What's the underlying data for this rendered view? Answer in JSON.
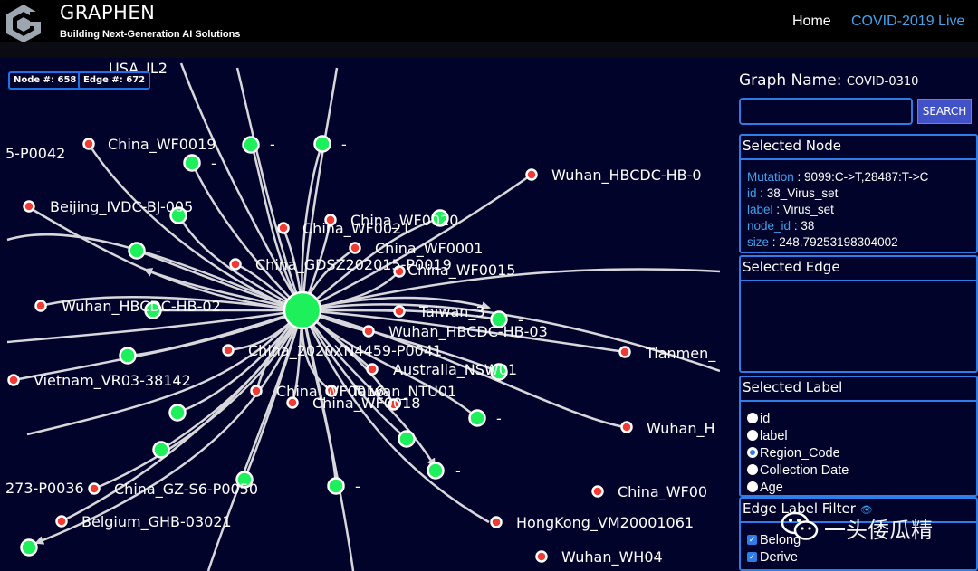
{
  "header": {
    "title": "GRAPHEN",
    "subtitle": "Building Next-Generation AI Solutions",
    "nav": {
      "home": "Home",
      "live": "COVID-2019 Live"
    }
  },
  "graph": {
    "node_count_label": "Node #: 658",
    "edge_count_label": "Edge #: 672",
    "labels": {
      "usa_il2": "USA_IL2",
      "p0042": "5-P0042",
      "china_wf0019": "China_WF0019",
      "dash1": "-",
      "dash2": "-",
      "dash3": "-",
      "dash4": "-",
      "dash5": "-",
      "dash6": "-",
      "dash7": "-",
      "dash8": "-",
      "dash9": "-",
      "wuhan_hbcdc_hb_0": "Wuhan_HBCDC-HB-0",
      "beijing": "Beijing_IVDC-BJ-005",
      "china_wf0021": "China_WF0021",
      "china_wf0020": "China_WF0020",
      "china_wf0001": "China_WF0001",
      "china_gdsz": "China_GDSZ202015-P0019",
      "china_wf0015": "China_WF0015",
      "wuhan_hb02": "Wuhan_HBCDC-HB-02",
      "taiwan3": "Taiwan_3",
      "wuhan_hb03": "Wuhan_HBCDC-HB-03",
      "china_2020xn": "China_2020XN4459-P0041",
      "tianmen": "Tianmen_",
      "vietnam": "Vietnam_VR03-38142",
      "australia": "Australia_NSW01",
      "china_wf0016": "China_WF0016",
      "taiwan_ntu": "Taiwan_NTU01",
      "china_wf0018": "China_WF0018",
      "wuhan_h": "Wuhan_H",
      "p0036": "273-P0036",
      "china_gz": "China_GZ-S6-P0050",
      "china_wf00": "China_WF00",
      "belgium": "Belgium_GHB-03021",
      "hongkong": "HongKong_VM20001061",
      "wuhan_wh04": "Wuhan_WH04"
    },
    "colors": {
      "hub": "#1df05a",
      "virus_set": "#1df05a",
      "sample": "#f03a32",
      "edge": "#d8d8dc"
    }
  },
  "panel": {
    "graph_name_label": "Graph Name:",
    "graph_name_value": "COVID-0310",
    "search_value": "",
    "search_button": "SEARCH",
    "selected_node": {
      "title": "Selected Node",
      "props": [
        {
          "key": "Mutation",
          "value": "9099:C->T,28487:T->C"
        },
        {
          "key": "id",
          "value": "38_Virus_set"
        },
        {
          "key": "label",
          "value": "Virus_set"
        },
        {
          "key": "node_id",
          "value": "38"
        },
        {
          "key": "size",
          "value": "248.79253198304002"
        }
      ]
    },
    "selected_edge": {
      "title": "Selected Edge"
    },
    "selected_label": {
      "title": "Selected Label",
      "options": [
        "id",
        "label",
        "Region_Code",
        "Collection Date",
        "Age"
      ],
      "selected": "Region_Code"
    },
    "edge_filter": {
      "title": "Edge Label Filter",
      "eye_icon": "eye-icon",
      "items": [
        "Belong",
        "Derive"
      ]
    }
  },
  "watermark": {
    "text": "一头倭瓜精"
  }
}
